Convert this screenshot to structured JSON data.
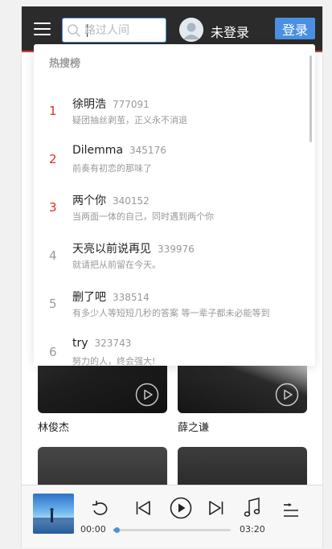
{
  "header": {
    "search_placeholder": "路过人间",
    "login_status": "未登录",
    "login_button": "登录"
  },
  "content": {
    "cards": [
      {
        "name": "林俊杰"
      },
      {
        "name": "薛之谦"
      },
      {
        "name": ""
      },
      {
        "name": ""
      }
    ]
  },
  "hot_search": {
    "title": "热搜榜",
    "items": [
      {
        "rank": "1",
        "title": "徐明浩",
        "score": "777091",
        "desc": "疑团抽丝剥茧，正义永不消退"
      },
      {
        "rank": "2",
        "title": "Dilemma",
        "score": "345176",
        "desc": "前奏有初恋的那味了"
      },
      {
        "rank": "3",
        "title": "两个你",
        "score": "340152",
        "desc": "当两面一体的自己，同时遇到两个你"
      },
      {
        "rank": "4",
        "title": "天亮以前说再见",
        "score": "339976",
        "desc": "就请把从前留在今天。"
      },
      {
        "rank": "5",
        "title": "删了吧",
        "score": "338514",
        "desc": "有多少人等短短几秒的答案 等一辈子都未必能等到"
      },
      {
        "rank": "6",
        "title": "try",
        "score": "323743",
        "desc": "努力的人，终会强大!"
      }
    ]
  },
  "player": {
    "current_time": "00:00",
    "total_time": "03:20",
    "progress": 0.03
  },
  "colors": {
    "header_bg": "#2b2b2b",
    "accent_red": "#d43c33",
    "accent_blue": "#4a90e2",
    "top_rank": "#e02e24"
  }
}
